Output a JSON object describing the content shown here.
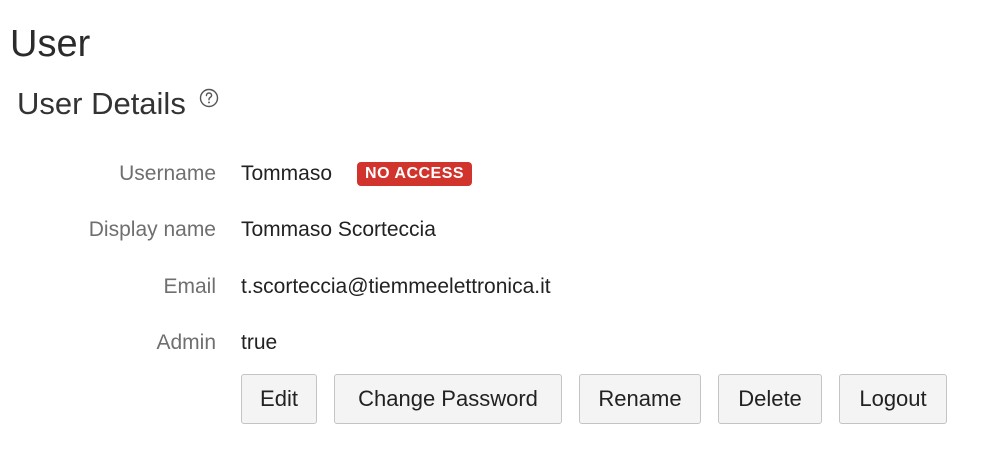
{
  "page": {
    "title": "User"
  },
  "section": {
    "title": "User Details",
    "help_icon": "help-circle-icon"
  },
  "details": {
    "username": {
      "label": "Username",
      "value": "Tommaso",
      "badge": "NO ACCESS",
      "badge_color": "#d0342c"
    },
    "display_name": {
      "label": "Display name",
      "value": "Tommaso Scorteccia"
    },
    "email": {
      "label": "Email",
      "value": "t.scorteccia@tiemmeelettronica.it"
    },
    "admin": {
      "label": "Admin",
      "value": "true"
    }
  },
  "actions": {
    "edit": "Edit",
    "change_password": "Change Password",
    "rename": "Rename",
    "delete": "Delete",
    "logout": "Logout"
  }
}
